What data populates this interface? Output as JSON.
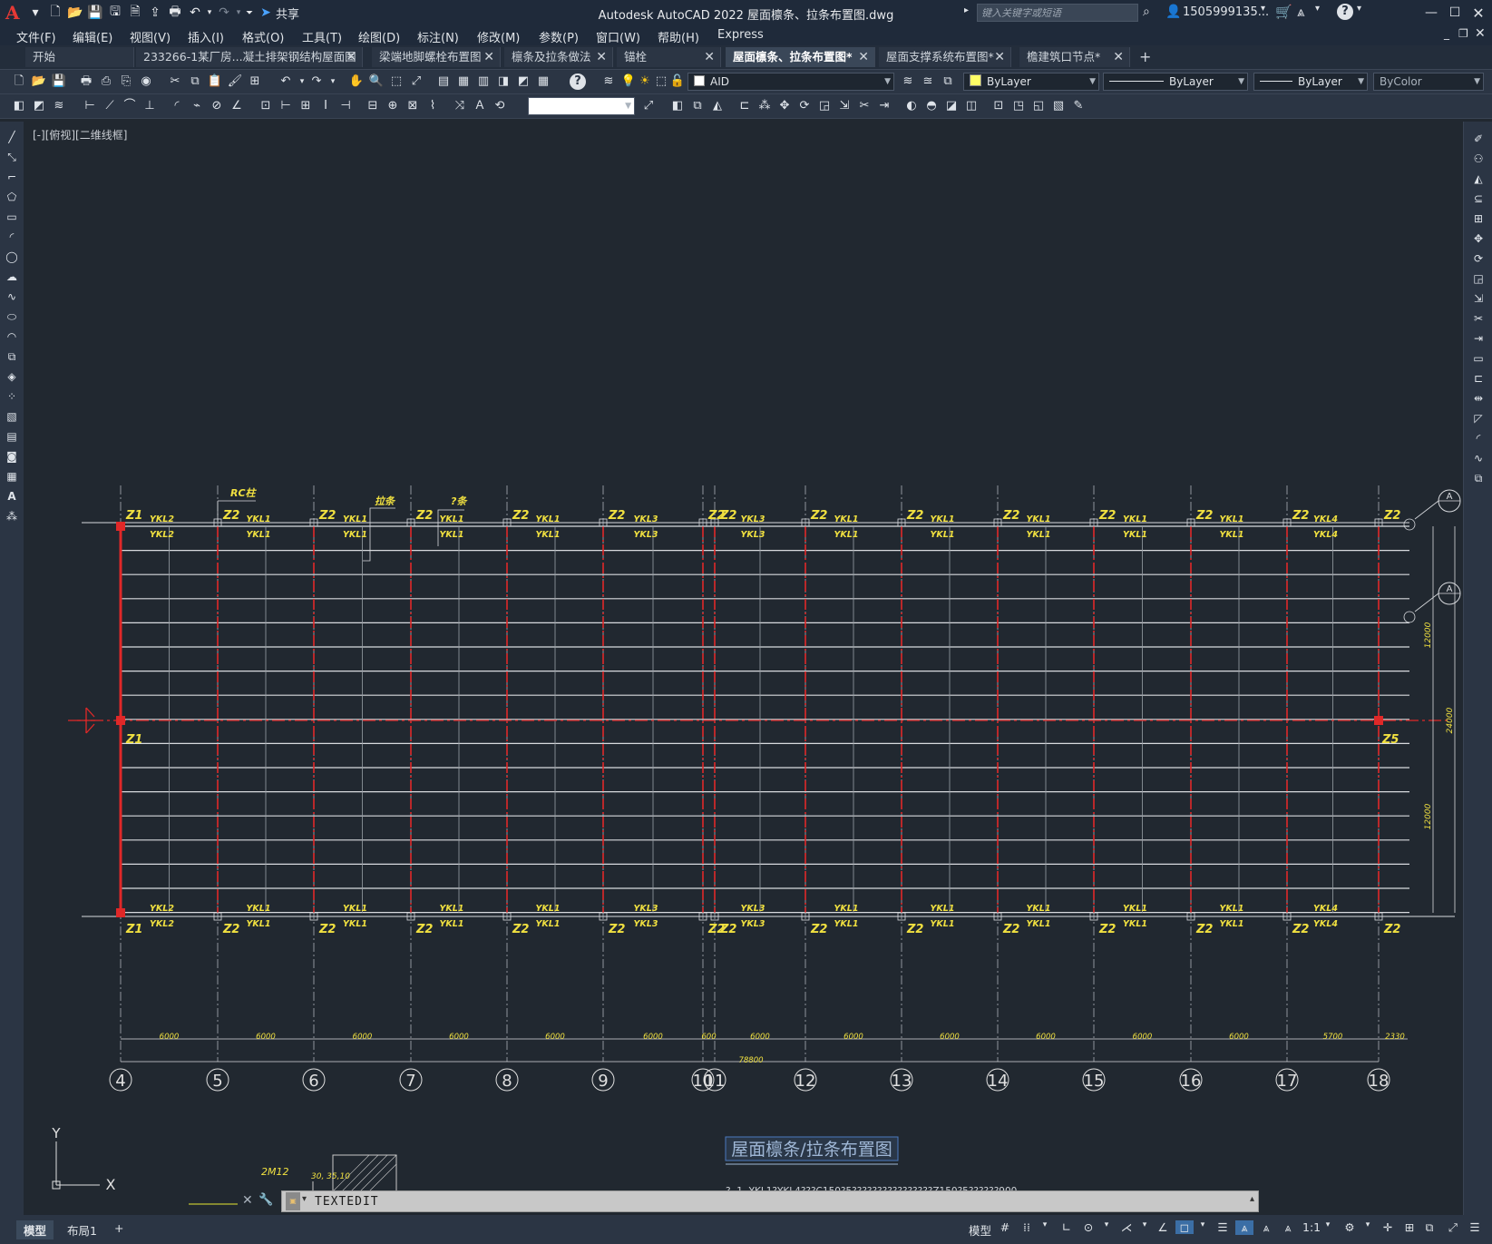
{
  "app": {
    "logo": "A",
    "window_title": "Autodesk AutoCAD 2022    屋面檩条、拉条布置图.dwg",
    "share_label": "共享",
    "search_placeholder": "键入关键字或短语",
    "user": "1505999135...",
    "help": "?"
  },
  "menu": [
    {
      "label": "文件(F)"
    },
    {
      "label": "编辑(E)"
    },
    {
      "label": "视图(V)"
    },
    {
      "label": "插入(I)"
    },
    {
      "label": "格式(O)"
    },
    {
      "label": "工具(T)"
    },
    {
      "label": "绘图(D)"
    },
    {
      "label": "标注(N)"
    },
    {
      "label": "修改(M)"
    },
    {
      "label": "参数(P)"
    },
    {
      "label": "窗口(W)"
    },
    {
      "label": "帮助(H)"
    },
    {
      "label": "Express"
    }
  ],
  "tabs": [
    {
      "label": "开始",
      "closable": false
    },
    {
      "label": "233266-1某厂房...凝土排架钢结构屋面图",
      "closable": true
    },
    {
      "label": "梁端地脚螺栓布置图",
      "closable": true
    },
    {
      "label": "檩条及拉条做法",
      "closable": true
    },
    {
      "label": "锚栓",
      "closable": true
    },
    {
      "label": "屋面檩条、拉条布置图*",
      "closable": true,
      "active": true
    },
    {
      "label": "屋面支撑系统布置图*",
      "closable": true
    },
    {
      "label": "檐建筑口节点*",
      "closable": true
    }
  ],
  "toolbar": {
    "layer_value": "AID",
    "color_value": "ByLayer",
    "linetype_value": "ByLayer",
    "lineweight_value": "ByLayer",
    "plotstyle_value": "ByColor",
    "dimstyle_value": ""
  },
  "drawing": {
    "view_label": "[-][俯视][二维线框]",
    "grid_labels": [
      "4",
      "5",
      "6",
      "7",
      "8",
      "9",
      "10",
      "11",
      "12",
      "13",
      "14",
      "15",
      "16",
      "17",
      "18"
    ],
    "spacing_dims": [
      "6000",
      "6000",
      "6000",
      "6000",
      "6000",
      "6000",
      "600",
      "6000",
      "6000",
      "6000",
      "6000",
      "6000",
      "6000",
      "5700",
      "2330"
    ],
    "total_dim": "78800",
    "right_dims": [
      "12000",
      "24000",
      "12000"
    ],
    "top_col_labels": [
      "Z1",
      "Z2",
      "Z2",
      "Z2",
      "Z2",
      "Z2",
      "Z2",
      "Z2",
      "Z2",
      "Z2",
      "Z2",
      "Z2",
      "Z2",
      "Z2",
      "Z2"
    ],
    "bottom_col_labels": [
      "Z1",
      "Z2",
      "Z2",
      "Z2",
      "Z2",
      "Z2",
      "Z2",
      "Z2",
      "Z2",
      "Z2",
      "Z2",
      "Z2",
      "Z2",
      "Z2",
      "Z2"
    ],
    "top_beam_labels": [
      "YKL2",
      "YKL1",
      "YKL1",
      "YKL1",
      "YKL1",
      "YKL3",
      "YKL3",
      "YKL1",
      "YKL1",
      "YKL1",
      "YKL1",
      "YKL1",
      "YKL4"
    ],
    "bottom_beam_labels": [
      "YKL2",
      "YKL1",
      "YKL1",
      "YKL1",
      "YKL1",
      "YKL3",
      "YKL3",
      "YKL1",
      "YKL1",
      "YKL1",
      "YKL1",
      "YKL1",
      "YKL4"
    ],
    "callouts": [
      "RC柱",
      "拉条",
      "?条"
    ],
    "mid_left_col": "Z1",
    "mid_right_col": "Z5",
    "axis_bubble": "A",
    "drawing_title": "屋面檩条/拉条布置图",
    "note_line": "?. 1. YKL1?YKL4???C150?5????????????????Z150?5??????900.",
    "partial_detail_labels": [
      "2M12",
      "30, 35,10"
    ],
    "ucs_x": "X",
    "ucs_y": "Y"
  },
  "command": {
    "text": "TEXTEDIT"
  },
  "layout_tabs": [
    {
      "label": "模型",
      "active": true
    },
    {
      "label": "布局1",
      "active": false
    },
    {
      "label": "+",
      "active": false
    }
  ],
  "status": {
    "model_label": "模型",
    "scale": "1:1"
  }
}
